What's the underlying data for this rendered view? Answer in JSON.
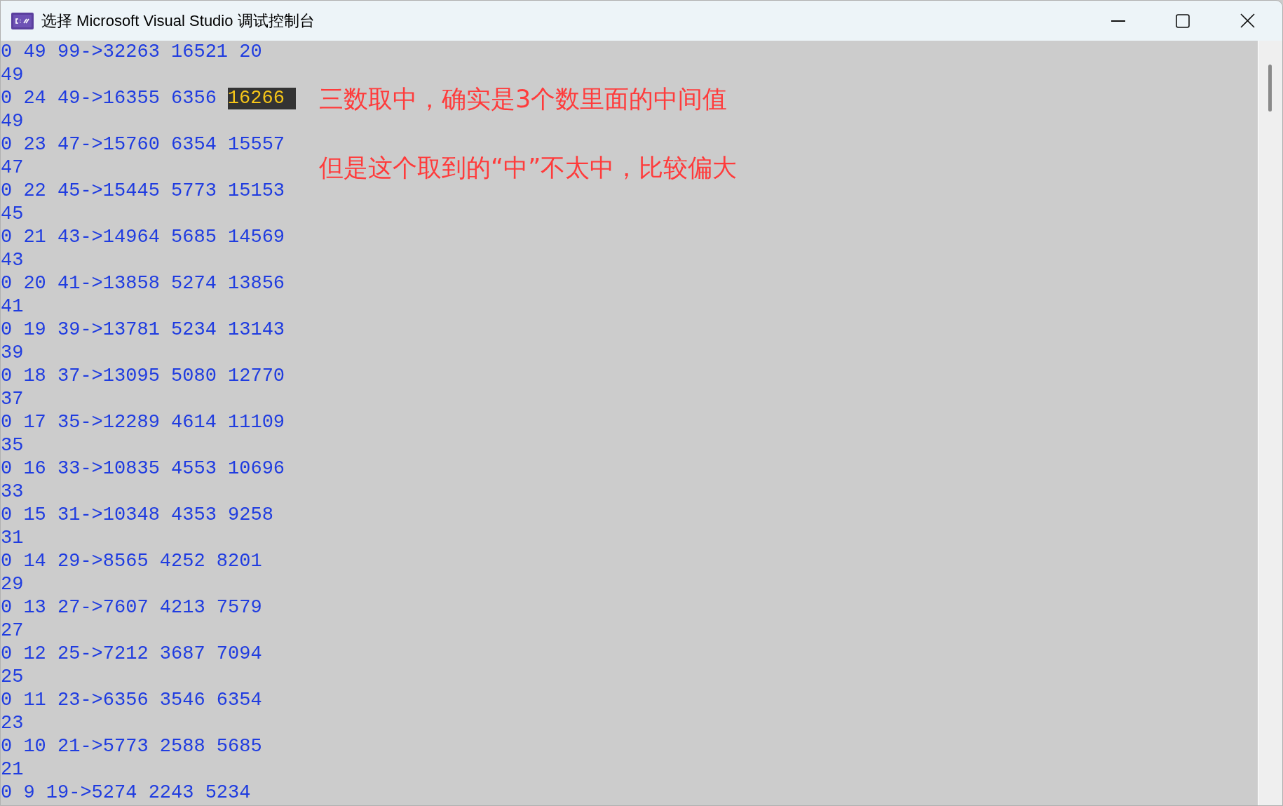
{
  "window": {
    "title": "选择 Microsoft Visual Studio 调试控制台"
  },
  "console_lines": [
    {
      "segments": [
        {
          "text": "0 49 99->32263 16521 20",
          "selected": false
        }
      ]
    },
    {
      "segments": [
        {
          "text": "49",
          "selected": false
        }
      ]
    },
    {
      "segments": [
        {
          "text": "0 24 49->16355 6356",
          "selected": false
        },
        {
          "text": "16266",
          "selected": true
        }
      ]
    },
    {
      "segments": [
        {
          "text": "49",
          "selected": false
        }
      ]
    },
    {
      "segments": [
        {
          "text": "0 23 47->15760 6354 15557",
          "selected": false
        }
      ]
    },
    {
      "segments": [
        {
          "text": "47",
          "selected": false
        }
      ]
    },
    {
      "segments": [
        {
          "text": "0 22 45->15445 5773 15153",
          "selected": false
        }
      ]
    },
    {
      "segments": [
        {
          "text": "45",
          "selected": false
        }
      ]
    },
    {
      "segments": [
        {
          "text": "0 21 43->14964 5685 14569",
          "selected": false
        }
      ]
    },
    {
      "segments": [
        {
          "text": "43",
          "selected": false
        }
      ]
    },
    {
      "segments": [
        {
          "text": "0 20 41->13858 5274 13856",
          "selected": false
        }
      ]
    },
    {
      "segments": [
        {
          "text": "41",
          "selected": false
        }
      ]
    },
    {
      "segments": [
        {
          "text": "0 19 39->13781 5234 13143",
          "selected": false
        }
      ]
    },
    {
      "segments": [
        {
          "text": "39",
          "selected": false
        }
      ]
    },
    {
      "segments": [
        {
          "text": "0 18 37->13095 5080 12770",
          "selected": false
        }
      ]
    },
    {
      "segments": [
        {
          "text": "37",
          "selected": false
        }
      ]
    },
    {
      "segments": [
        {
          "text": "0 17 35->12289 4614 11109",
          "selected": false
        }
      ]
    },
    {
      "segments": [
        {
          "text": "35",
          "selected": false
        }
      ]
    },
    {
      "segments": [
        {
          "text": "0 16 33->10835 4553 10696",
          "selected": false
        }
      ]
    },
    {
      "segments": [
        {
          "text": "33",
          "selected": false
        }
      ]
    },
    {
      "segments": [
        {
          "text": "0 15 31->10348 4353 9258",
          "selected": false
        }
      ]
    },
    {
      "segments": [
        {
          "text": "31",
          "selected": false
        }
      ]
    },
    {
      "segments": [
        {
          "text": "0 14 29->8565 4252 8201",
          "selected": false
        }
      ]
    },
    {
      "segments": [
        {
          "text": "29",
          "selected": false
        }
      ]
    },
    {
      "segments": [
        {
          "text": "0 13 27->7607 4213 7579",
          "selected": false
        }
      ]
    },
    {
      "segments": [
        {
          "text": "27",
          "selected": false
        }
      ]
    },
    {
      "segments": [
        {
          "text": "0 12 25->7212 3687 7094",
          "selected": false
        }
      ]
    },
    {
      "segments": [
        {
          "text": "25",
          "selected": false
        }
      ]
    },
    {
      "segments": [
        {
          "text": "0 11 23->6356 3546 6354",
          "selected": false
        }
      ]
    },
    {
      "segments": [
        {
          "text": "23",
          "selected": false
        }
      ]
    },
    {
      "segments": [
        {
          "text": "0 10 21->5773 2588 5685",
          "selected": false
        }
      ]
    },
    {
      "segments": [
        {
          "text": "21",
          "selected": false
        }
      ]
    },
    {
      "segments": [
        {
          "text": "0 9 19->5274 2243 5234",
          "selected": false
        }
      ]
    }
  ],
  "annotations": [
    "三数取中，确实是3个数里面的中间值",
    "但是这个取到的“中”不太中，比较偏大"
  ]
}
